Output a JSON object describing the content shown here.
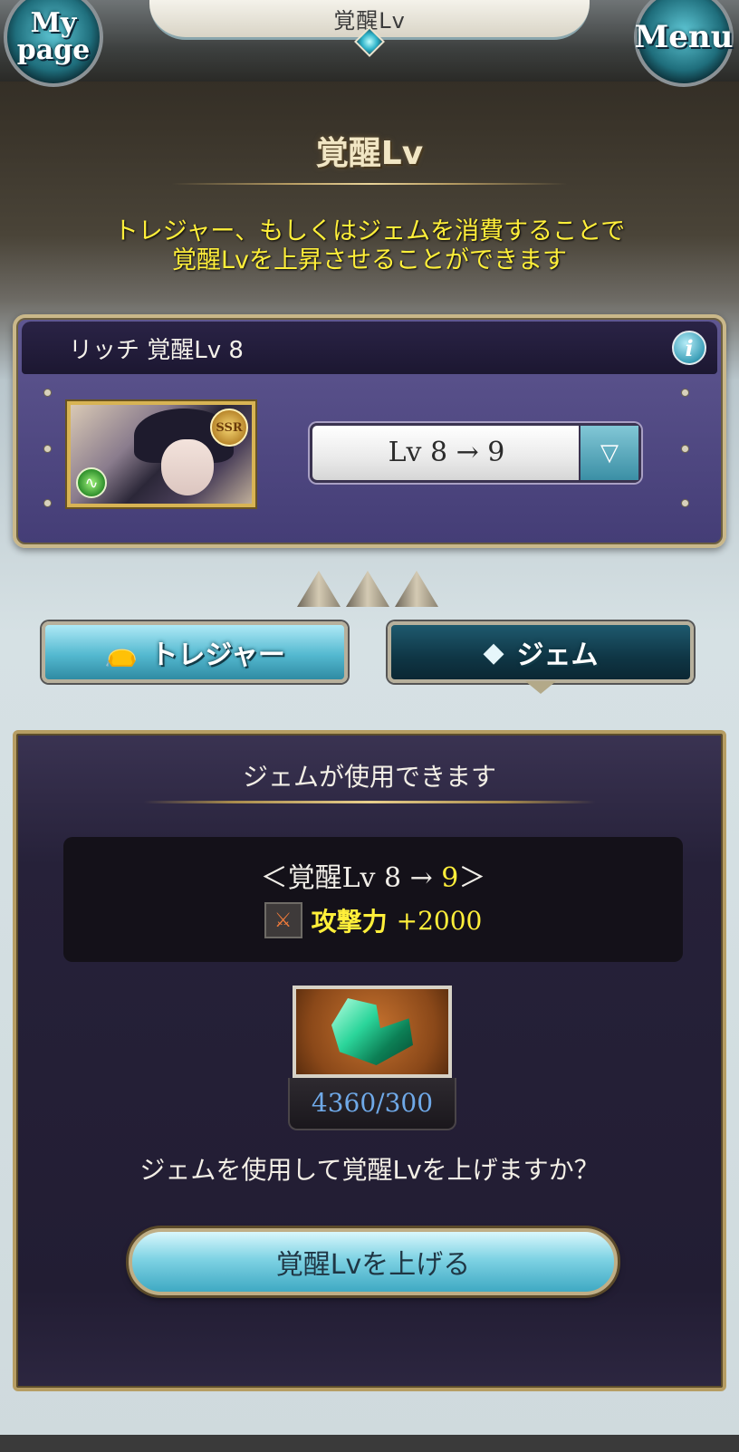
{
  "header": {
    "title": "覚醒Lv",
    "mypage_label": "My\npage",
    "menu_label": "Menu"
  },
  "heading": "覚醒Lv",
  "description": "トレジャー、もしくはジェムを消費することで\n覚醒Lvを上昇させることができます",
  "character": {
    "name_label": "リッチ 覚醒Lv 8",
    "rarity": "SSR",
    "info_icon": "i",
    "level_select_value": "Lv 8 → 9",
    "level_select_arrow": "▽"
  },
  "tabs": {
    "treasure_label": "トレジャー",
    "gem_label": "ジェム",
    "active": "gem"
  },
  "gem_panel": {
    "title": "ジェムが使用できます",
    "upgrade_prefix": "＜覚醒Lv 8 → ",
    "upgrade_target": "9",
    "upgrade_suffix": "＞",
    "stat_label": "攻撃力",
    "stat_value": "+2000",
    "gem_count": "4360/300",
    "question": "ジェムを使用して覚醒Lvを上げますか？",
    "confirm_button": "覚醒Lvを上げる"
  },
  "colors": {
    "accent_yellow": "#ffef3a",
    "gem_count_blue": "#6fa9e8",
    "panel_purple": "#443d76"
  }
}
